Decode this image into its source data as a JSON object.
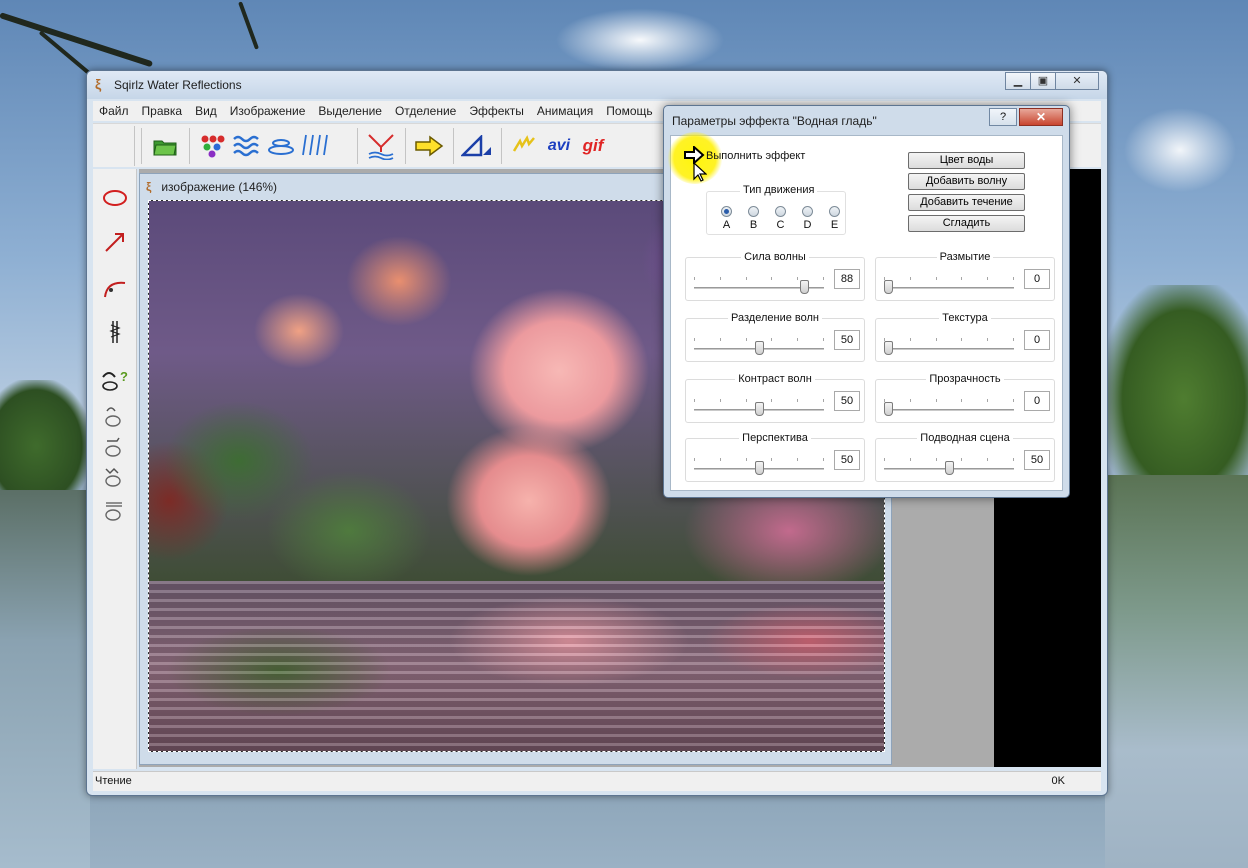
{
  "window": {
    "title": "Sqirlz Water Reflections",
    "minimize_label": "▭",
    "maximize_label": "▣",
    "close_label": "✕"
  },
  "menu": [
    "Файл",
    "Правка",
    "Вид",
    "Изображение",
    "Выделение",
    "Отделение",
    "Эффекты",
    "Анимация",
    "Помощь"
  ],
  "toolbar": {
    "icons": [
      "open-folder-icon",
      "dots-icon",
      "waves-icon",
      "ripple-icon",
      "rain-icon",
      "reflect-icon",
      "arrow-right-icon",
      "perspective-icon",
      "lightning-icon",
      "avi-icon",
      "gif-icon"
    ],
    "avi_label": "avi",
    "gif_label": "gif"
  },
  "left_toolbar": {
    "icons": [
      "ellipse-icon",
      "arrow-icon",
      "curve-icon",
      "zigzag-icon",
      "wave-help-icon",
      "drop1-icon",
      "drop2-icon",
      "drop3-icon",
      "drop4-icon"
    ]
  },
  "document": {
    "title": "изображение (146%)"
  },
  "status": {
    "left": "Чтение",
    "right": "0K"
  },
  "dialog": {
    "title": "Параметры эффекта \"Водная гладь\"",
    "help_label": "?",
    "close_label": "✕",
    "run_label": "Выполнить эффект",
    "motion_label": "Тип движения",
    "motion_options": [
      "A",
      "B",
      "C",
      "D",
      "E"
    ],
    "motion_selected": "A",
    "buttons": {
      "water_color": "Цвет воды",
      "add_wave": "Добавить волну",
      "add_current": "Добавить течение",
      "smooth": "Сгладить"
    },
    "params": [
      {
        "label": "Сила волны",
        "value": "88",
        "level": 88
      },
      {
        "label": "Размытие",
        "value": "0",
        "level": 0
      },
      {
        "label": "Разделение волн",
        "value": "50",
        "level": 50
      },
      {
        "label": "Текстура",
        "value": "0",
        "level": 0
      },
      {
        "label": "Контраст волн",
        "value": "50",
        "level": 50
      },
      {
        "label": "Прозрачность",
        "value": "0",
        "level": 0
      },
      {
        "label": "Перспектива",
        "value": "50",
        "level": 50
      },
      {
        "label": "Подводная сцена",
        "value": "50",
        "level": 50
      }
    ]
  }
}
